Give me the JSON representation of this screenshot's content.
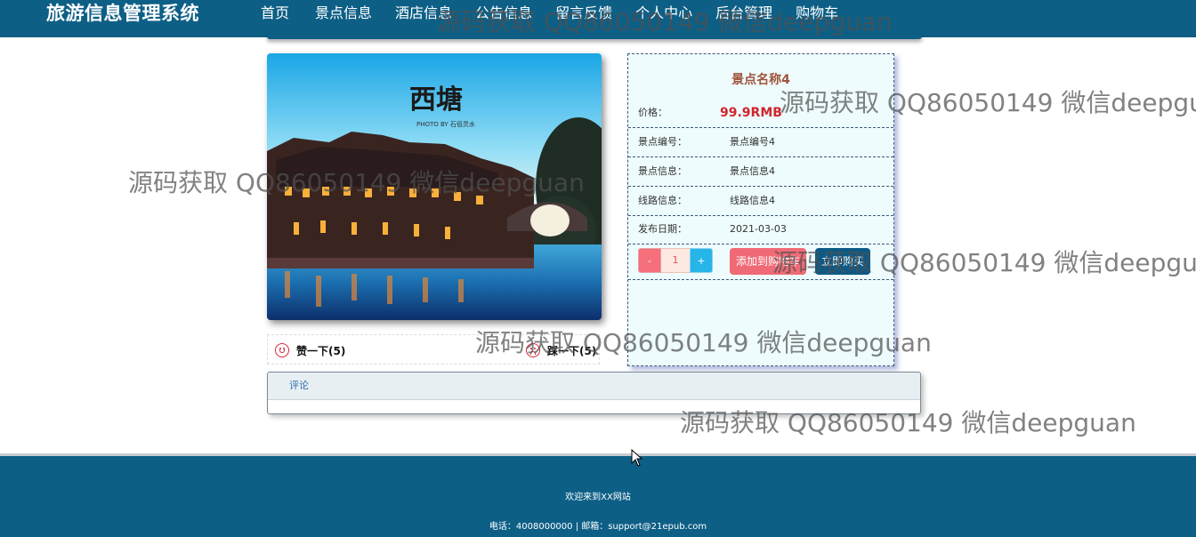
{
  "header": {
    "brand": "旅游信息管理系统",
    "nav": [
      {
        "label": "首页",
        "active": false
      },
      {
        "label": "景点信息",
        "active": true
      },
      {
        "label": "酒店信息",
        "active": false
      },
      {
        "label": "公告信息",
        "active": false
      },
      {
        "label": "留言反馈",
        "active": false
      },
      {
        "label": "个人中心",
        "active": false
      },
      {
        "label": "后台管理",
        "active": false
      },
      {
        "label": "购物车",
        "active": false
      }
    ]
  },
  "photo": {
    "caption_big": "西塘",
    "caption_small": "PHOTO BY 石佰灵水"
  },
  "vote": {
    "like": "赞一下(5)",
    "dislike": "踩一下(5)"
  },
  "detail": {
    "title": "景点名称4",
    "price_label": "价格：",
    "price_value": "99.9RMB",
    "rows": [
      {
        "label": "景点编号：",
        "value": "景点编号4"
      },
      {
        "label": "景点信息：",
        "value": "景点信息4"
      },
      {
        "label": "线路信息：",
        "value": "线路信息4"
      },
      {
        "label": "发布日期：",
        "value": "2021-03-03"
      }
    ],
    "qty": {
      "minus": "-",
      "value": "1",
      "plus": "+"
    },
    "add_to_cart": "添加到购物车",
    "buy_now": "立即购买"
  },
  "comments": {
    "heading": "评论"
  },
  "footer": {
    "welcome": "欢迎来到XX网站",
    "contact": "电话：4008000000 | 邮箱：support@21epub.com"
  },
  "watermark": "源码获取 QQ86050149 微信deepguan",
  "colors": {
    "primary": "#0d5f86",
    "price": "#d0252d",
    "title": "#a0553b",
    "cart_button": "#f06a76",
    "buy_button": "#0b5a87"
  }
}
